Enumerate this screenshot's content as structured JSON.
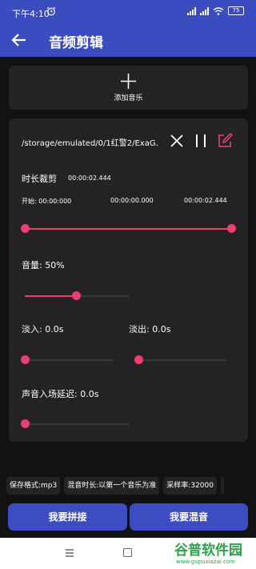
{
  "status_bar": {
    "time": "下午4:10",
    "battery": "75"
  },
  "app_bar": {
    "title": "音频剪辑",
    "back_icon": "arrow-left-icon"
  },
  "add_music": {
    "label": "添加音乐",
    "icon": "plus-icon"
  },
  "track": {
    "path": "/storage/emulated/0/1红警2/ExaG…",
    "close_icon": "close-icon",
    "pause_icon": "pause-icon",
    "edit_icon": "edit-icon",
    "trim": {
      "label": "时长裁剪",
      "duration": "00:00:02.444",
      "start_label": "开始: 00:00:000",
      "start_value": "00:00:00.000",
      "end_value": "00:00:02.444",
      "start_fraction": 0.0,
      "end_fraction": 1.0
    },
    "volume": {
      "label": "音量: 50%",
      "fraction": 0.5
    },
    "fade_in": {
      "label": "淡入: 0.0s",
      "fraction": 0.0
    },
    "fade_out": {
      "label": "淡出: 0.0s",
      "fraction": 0.0
    },
    "delay": {
      "label": "声音入场延迟: 0.0s",
      "fraction": 0.0
    }
  },
  "settings_chips": [
    "保存格式:mp3",
    "混音时长:以第一个音乐为准",
    "采样率:32000"
  ],
  "buttons": {
    "splice": "我要拼接",
    "mix": "我要混音"
  },
  "accent_color": "#ee3e6e",
  "primary_color": "#3a4cc0",
  "watermark": {
    "title": "谷普软件园",
    "url": "www.gupuxiazai.com"
  }
}
